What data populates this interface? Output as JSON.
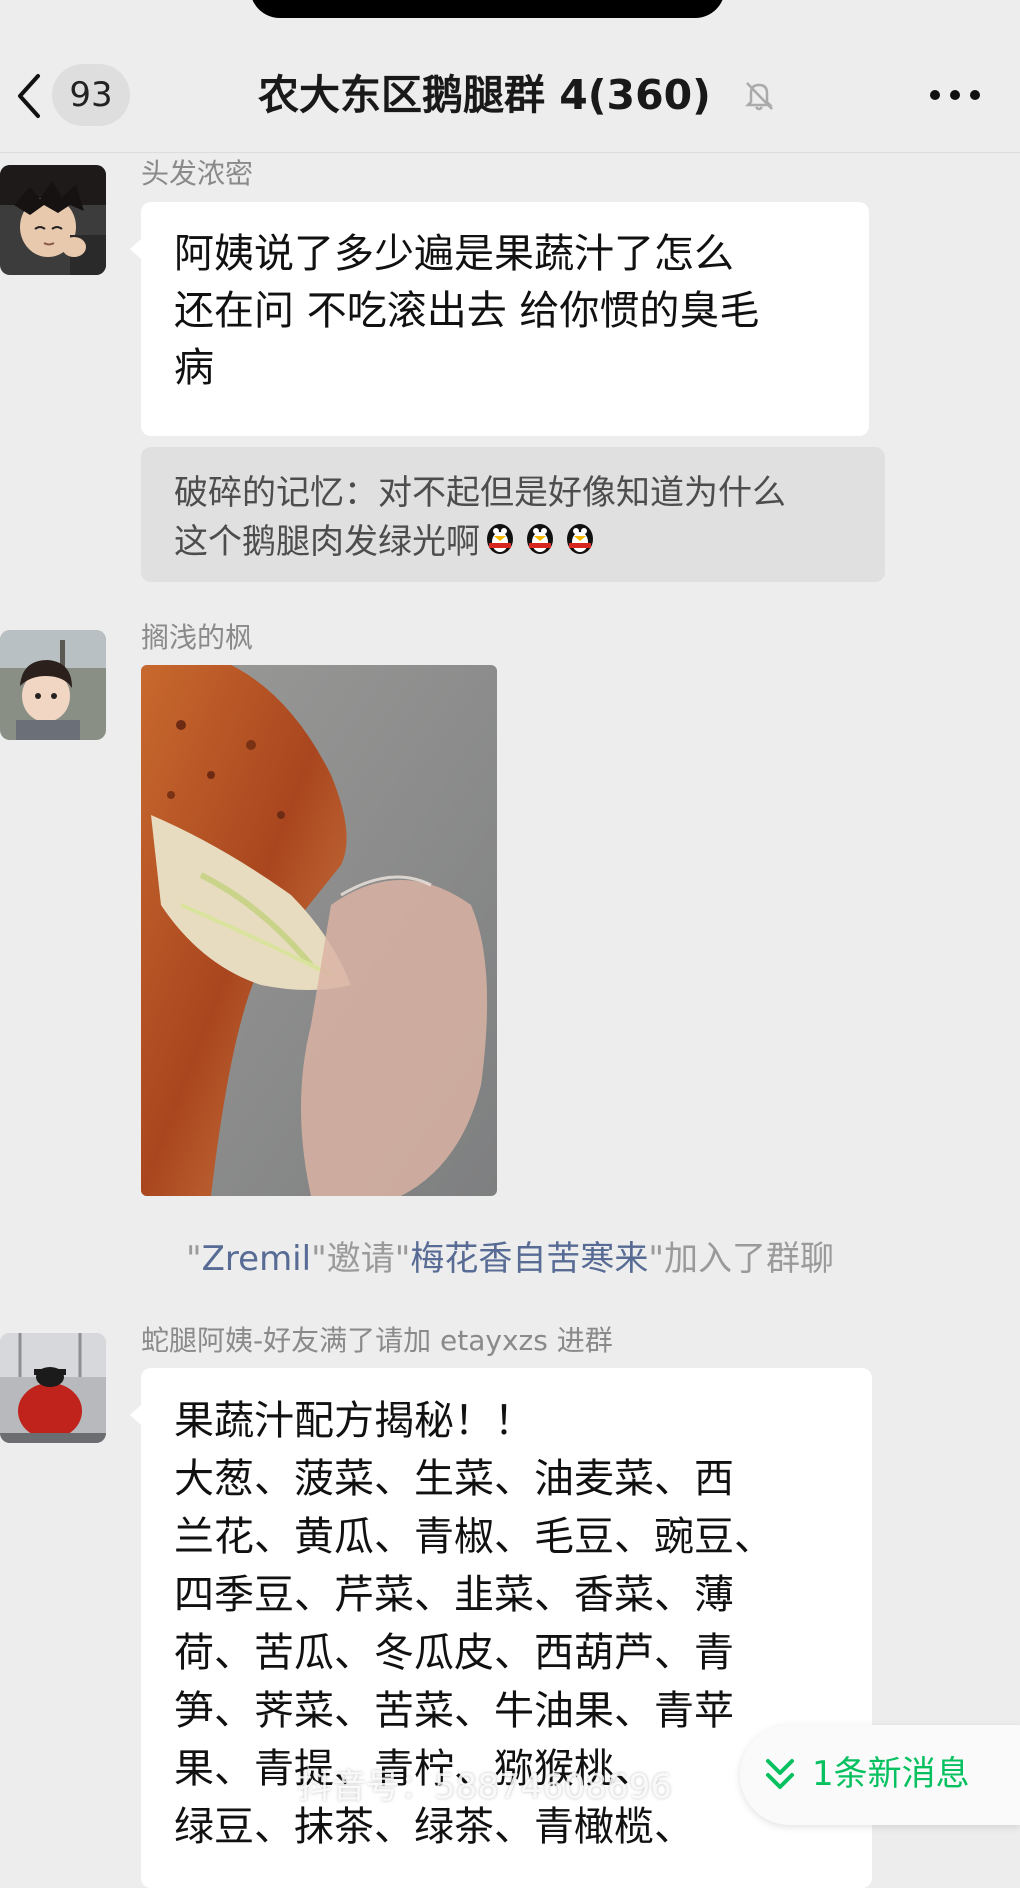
{
  "header": {
    "back_icon": "chevron-left-icon",
    "unread_count": "93",
    "title": "农大东区鹅腿群 4(360)",
    "mute_icon": "bell-off-icon",
    "more_icon": "more-dots-icon"
  },
  "messages": [
    {
      "sender": "头发浓密",
      "text": "阿姨说了多少遍是果蔬汁了怎么\n还在问 不吃滚出去 给你惯的臭毛\n病",
      "quote": {
        "text": "破碎的记忆：对不起但是好像知道为什么\n这个鹅腿肉发绿光啊"
      }
    },
    {
      "sender": "搁浅的枫",
      "image": "roasted goose leg photo"
    },
    {
      "sender": "蛇腿阿姨-好友满了请加 etayxzs 进群",
      "text": "果蔬汁配方揭秘！！\n大葱、菠菜、生菜、油麦菜、西\n兰花、黄瓜、青椒、毛豆、豌豆、\n四季豆、芹菜、韭菜、香菜、薄\n荷、苦瓜、冬瓜皮、西葫芦、青\n笋、荠菜、苦菜、牛油果、青苹\n果、青提、青柠、猕猴桃、\n绿豆、抹茶、绿茶、青橄榄、"
    }
  ],
  "system_notice": {
    "inviter": "Zremil",
    "invited_word": "邀请",
    "invitee": "梅花香自苦寒来",
    "joined": "加入了群聊"
  },
  "new_messages": {
    "icon": "double-chevron-down-icon",
    "label": "1条新消息"
  },
  "watermark": "抖音号：58874608696",
  "colors": {
    "background": "#ededed",
    "bubble": "#ffffff",
    "link": "#576b95",
    "accent_green": "#07c160"
  }
}
